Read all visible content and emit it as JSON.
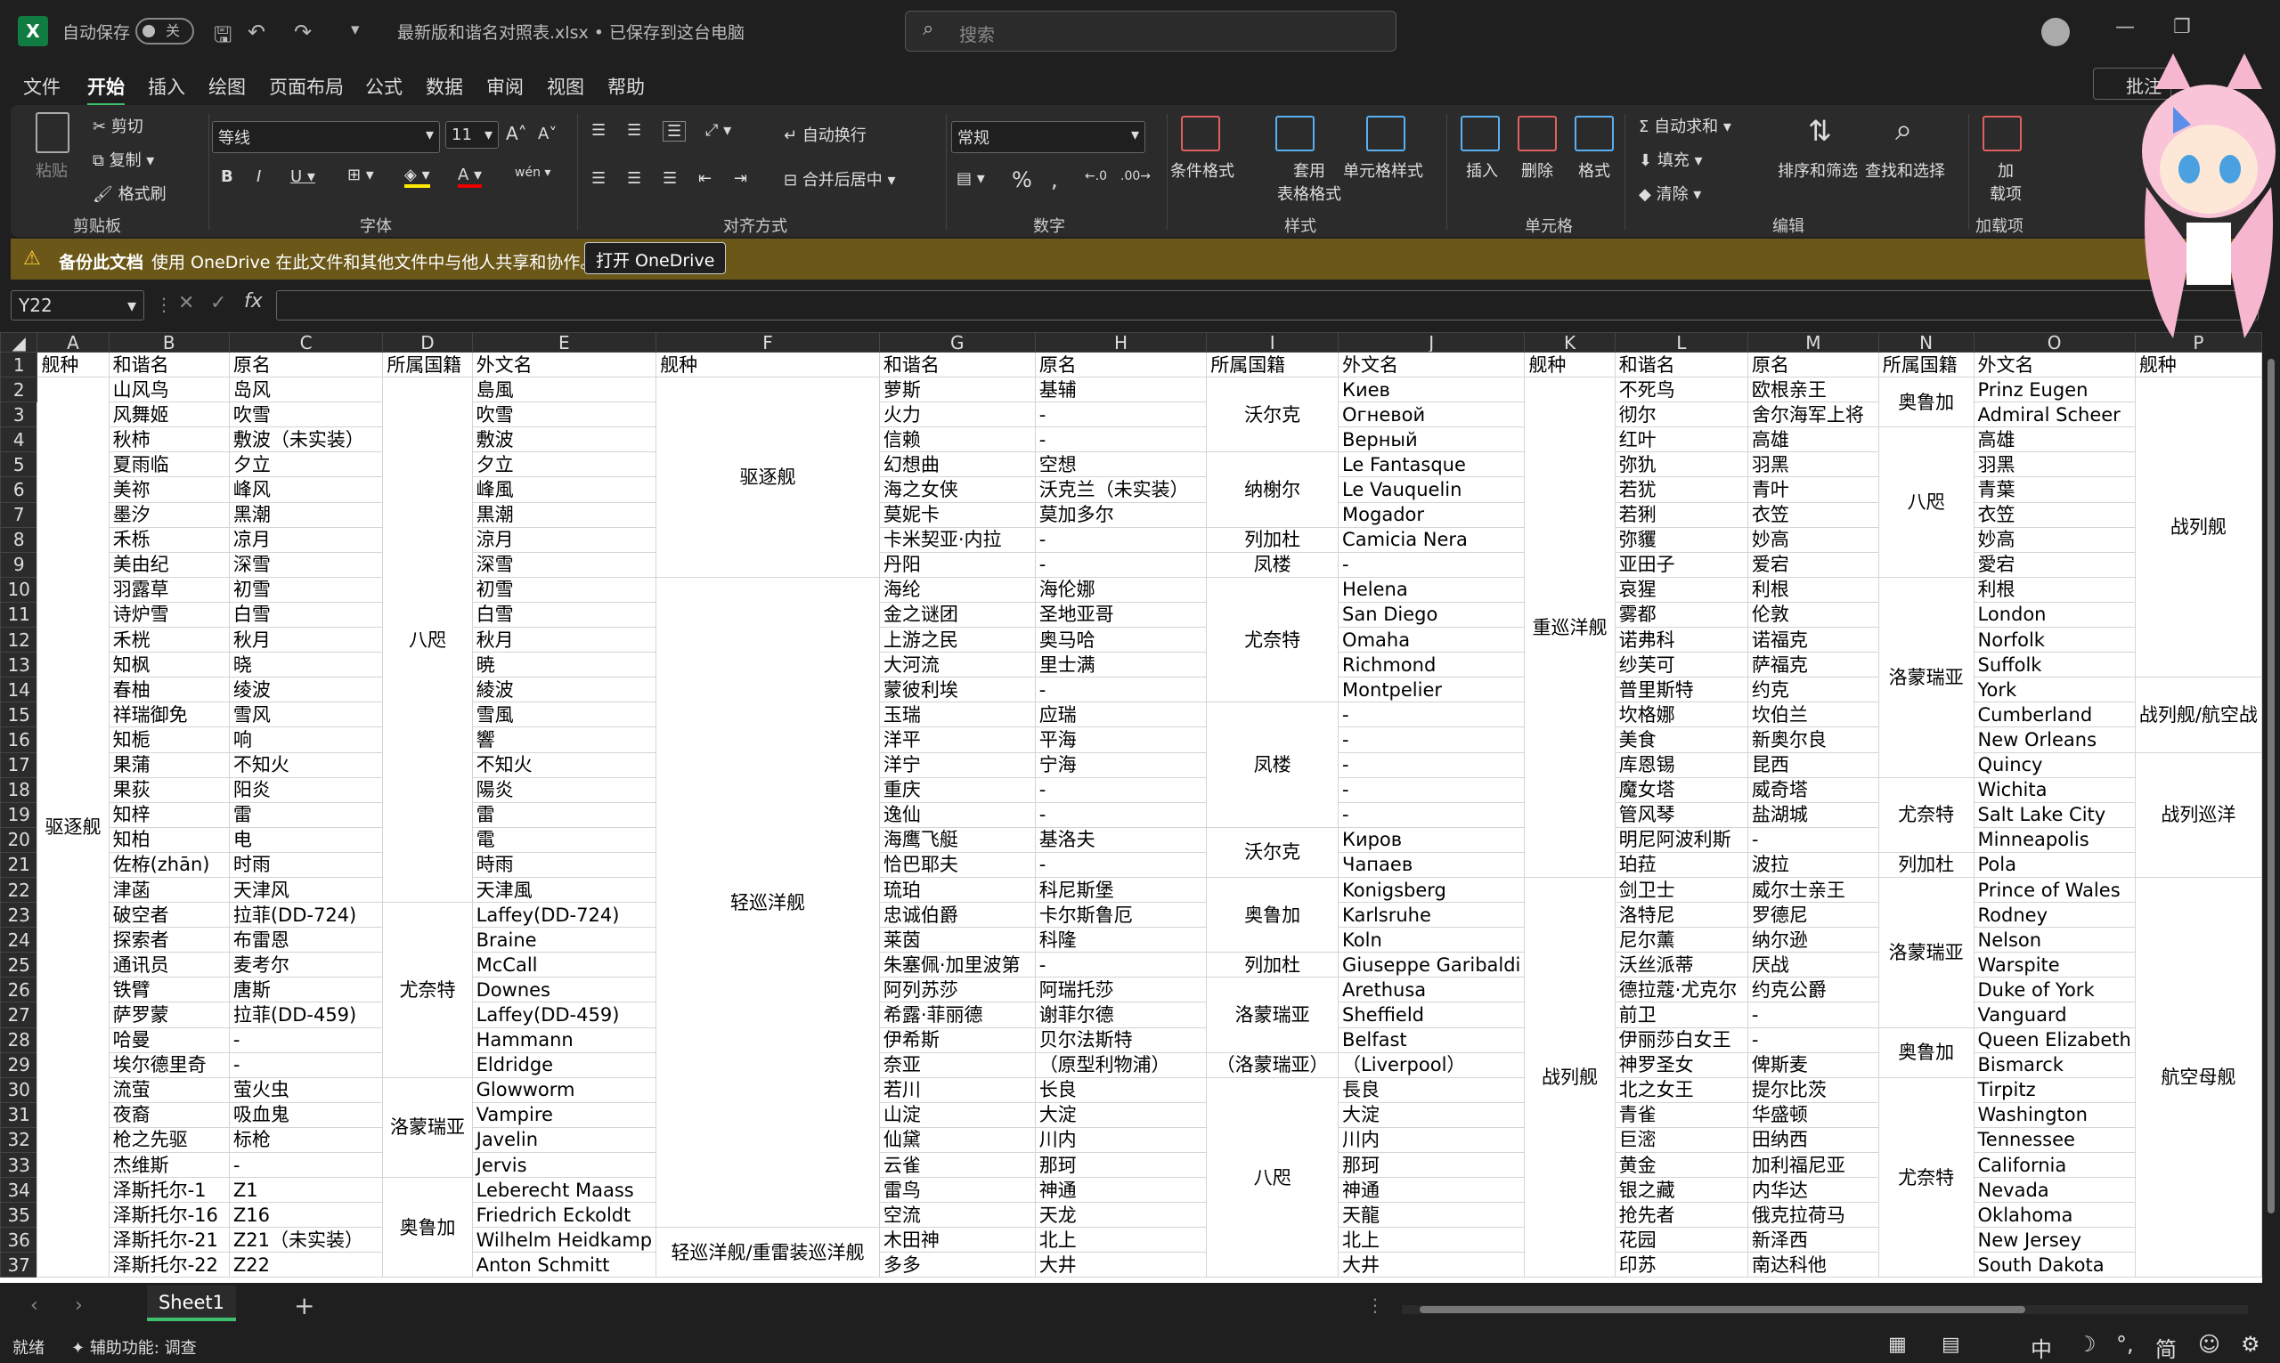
{
  "titlebar": {
    "autosave": "自动保存",
    "autosave_state": "关",
    "filename": "最新版和谐名对照表.xlsx • 已保存到这台电脑",
    "search_placeholder": "搜索"
  },
  "menu": [
    "文件",
    "开始",
    "插入",
    "绘图",
    "页面布局",
    "公式",
    "数据",
    "审阅",
    "视图",
    "帮助"
  ],
  "menu_active": 1,
  "comment_btn": "批注",
  "ribbon": {
    "clipboard": {
      "paste": "粘贴",
      "cut": "剪切",
      "copy": "复制",
      "format_painter": "格式刷",
      "label": "剪贴板"
    },
    "font": {
      "name": "等线",
      "size": "11",
      "label": "字体"
    },
    "align": {
      "wrap": "自动换行",
      "merge": "合并后居中",
      "label": "对齐方式"
    },
    "number": {
      "format": "常规",
      "label": "数字"
    },
    "styles": {
      "cond": "条件格式",
      "table": "套用\n表格格式",
      "cell": "单元格样式",
      "label": "样式"
    },
    "cells": {
      "insert": "插入",
      "delete": "删除",
      "format": "格式",
      "label": "单元格"
    },
    "edit": {
      "autosum": "自动求和",
      "fill": "填充",
      "clear": "清除",
      "sort": "排序和筛选",
      "find": "查找和选择",
      "label": "编辑"
    },
    "addins": {
      "btn": "加\n载项",
      "label": "加载项"
    }
  },
  "infobar": {
    "title": "备份此文档",
    "msg": "使用 OneDrive 在此文件和其他文件中与他人共享和协作。",
    "btn": "打开 OneDrive"
  },
  "namebox": "Y22",
  "columns": [
    "A",
    "B",
    "C",
    "D",
    "E",
    "F",
    "G",
    "H",
    "I",
    "J",
    "K",
    "L",
    "M",
    "N",
    "O",
    "P"
  ],
  "headers": [
    "舰种",
    "和谐名",
    "原名",
    "所属国籍",
    "外文名",
    "舰种",
    "和谐名",
    "原名",
    "所属国籍",
    "外文名",
    "舰种",
    "和谐名",
    "原名",
    "所属国籍",
    "外文名",
    "舰种"
  ],
  "rows": [
    [
      "",
      "山风鸟",
      "岛风",
      "",
      "島風",
      "",
      "萝斯",
      "基辅",
      "",
      "Киев",
      "",
      "不死鸟",
      "欧根亲王",
      "",
      "Prinz Eugen",
      ""
    ],
    [
      "",
      "风舞姬",
      "吹雪",
      "",
      "吹雪",
      "",
      "火力",
      "-",
      "",
      "Огневой",
      "",
      "彻尔",
      "舍尔海军上将",
      "",
      "Admiral Scheer",
      ""
    ],
    [
      "",
      "秋柿",
      "敷波（未实装）",
      "",
      "敷波",
      "",
      "信赖",
      "-",
      "",
      "Верный",
      "",
      "红叶",
      "高雄",
      "",
      "高雄",
      ""
    ],
    [
      "",
      "夏雨临",
      "夕立",
      "",
      "夕立",
      "",
      "幻想曲",
      "空想",
      "",
      "Le Fantasque",
      "",
      "弥犰",
      "羽黑",
      "",
      "羽黑",
      ""
    ],
    [
      "",
      "美祢",
      "峰风",
      "",
      "峰風",
      "",
      "海之女侠",
      "沃克兰（未实装）",
      "",
      "Le Vauquelin",
      "",
      "若犹",
      "青叶",
      "",
      "青葉",
      ""
    ],
    [
      "",
      "墨汐",
      "黑潮",
      "",
      "黒潮",
      "",
      "莫妮卡",
      "莫加多尔",
      "",
      "Mogador",
      "",
      "若猁",
      "衣笠",
      "",
      "衣笠",
      ""
    ],
    [
      "",
      "禾栎",
      "凉月",
      "",
      "涼月",
      "",
      "卡米契亚·内拉",
      "-",
      "",
      "Camicia Nera",
      "",
      "弥貜",
      "妙高",
      "",
      "妙高",
      ""
    ],
    [
      "",
      "美由纪",
      "深雪",
      "",
      "深雪",
      "",
      "丹阳",
      "-",
      "",
      "-",
      "",
      "亚田子",
      "爱宕",
      "",
      "愛宕",
      ""
    ],
    [
      "",
      "羽露草",
      "初雪",
      "",
      "初雪",
      "",
      "海纶",
      "海伦娜",
      "",
      "Helena",
      "",
      "哀猩",
      "利根",
      "",
      "利根",
      ""
    ],
    [
      "",
      "诗炉雪",
      "白雪",
      "",
      "白雪",
      "",
      "金之谜团",
      "圣地亚哥",
      "",
      "San Diego",
      "",
      "雾都",
      "伦敦",
      "",
      "London",
      ""
    ],
    [
      "",
      "禾桄",
      "秋月",
      "",
      "秋月",
      "",
      "上游之民",
      "奥马哈",
      "",
      "Omaha",
      "",
      "诺弗科",
      "诺福克",
      "",
      "Norfolk",
      ""
    ],
    [
      "",
      "知枫",
      "晓",
      "",
      "暁",
      "",
      "大河流",
      "里士满",
      "",
      "Richmond",
      "",
      "纱芙可",
      "萨福克",
      "",
      "Suffolk",
      ""
    ],
    [
      "",
      "春柚",
      "绫波",
      "",
      "綾波",
      "",
      "蒙彼利埃",
      "-",
      "",
      "Montpelier",
      "",
      "普里斯特",
      "约克",
      "",
      "York",
      ""
    ],
    [
      "",
      "祥瑞御免",
      "雪风",
      "",
      "雪風",
      "",
      "玉瑞",
      "应瑞",
      "",
      "-",
      "",
      "坎格娜",
      "坎伯兰",
      "",
      "Cumberland",
      ""
    ],
    [
      "",
      "知栀",
      "响",
      "",
      "響",
      "",
      "洋平",
      "平海",
      "",
      "-",
      "",
      "美食",
      "新奥尔良",
      "",
      "New Orleans",
      ""
    ],
    [
      "",
      "果蒲",
      "不知火",
      "",
      "不知火",
      "",
      "洋宁",
      "宁海",
      "",
      "-",
      "",
      "库恩锡",
      "昆西",
      "",
      "Quincy",
      ""
    ],
    [
      "",
      "果荻",
      "阳炎",
      "",
      "陽炎",
      "",
      "重庆",
      "-",
      "",
      "-",
      "",
      "魔女塔",
      "威奇塔",
      "",
      "Wichita",
      ""
    ],
    [
      "",
      "知梓",
      "雷",
      "",
      "雷",
      "",
      "逸仙",
      "-",
      "",
      "-",
      "",
      "管风琴",
      "盐湖城",
      "",
      "Salt Lake City",
      ""
    ],
    [
      "",
      "知柏",
      "电",
      "",
      "電",
      "",
      "海鹰飞艇",
      "基洛夫",
      "",
      "Киров",
      "",
      "明尼阿波利斯",
      "-",
      "",
      "Minneapolis",
      ""
    ],
    [
      "",
      "佐栫(zhān)",
      "时雨",
      "",
      "時雨",
      "",
      "恰巴耶夫",
      "-",
      "",
      "Чапаев",
      "",
      "珀菈",
      "波拉",
      "",
      "Pola",
      ""
    ],
    [
      "",
      "津菡",
      "天津风",
      "",
      "天津風",
      "",
      "琉珀",
      "科尼斯堡",
      "",
      "Konigsberg",
      "",
      "剑卫士",
      "威尔士亲王",
      "",
      "Prince of Wales",
      ""
    ],
    [
      "",
      "破空者",
      "拉菲(DD-724)",
      "",
      "Laffey(DD-724)",
      "",
      "忠诚伯爵",
      "卡尔斯鲁厄",
      "",
      "Karlsruhe",
      "",
      "洛特尼",
      "罗德尼",
      "",
      "Rodney",
      ""
    ],
    [
      "",
      "探索者",
      "布雷恩",
      "",
      "Braine",
      "",
      "莱茵",
      "科隆",
      "",
      "Koln",
      "",
      "尼尔薰",
      "纳尔逊",
      "",
      "Nelson",
      ""
    ],
    [
      "",
      "通讯员",
      "麦考尔",
      "",
      "McCall",
      "",
      "朱塞佩·加里波第",
      "-",
      "",
      "Giuseppe Garibaldi",
      "",
      "沃丝派蒂",
      "厌战",
      "",
      "Warspite",
      ""
    ],
    [
      "",
      "铁臂",
      "唐斯",
      "",
      "Downes",
      "",
      "阿列苏莎",
      "阿瑞托莎",
      "",
      "Arethusa",
      "",
      "德拉蔻·尤克尔",
      "约克公爵",
      "",
      "Duke of York",
      ""
    ],
    [
      "",
      "萨罗蒙",
      "拉菲(DD-459)",
      "",
      "Laffey(DD-459)",
      "",
      "希露·菲丽德",
      "谢菲尔德",
      "",
      "Sheffield",
      "",
      "前卫",
      "-",
      "",
      "Vanguard",
      ""
    ],
    [
      "",
      "哈曼",
      "-",
      "",
      "Hammann",
      "",
      "伊希斯",
      "贝尔法斯特",
      "",
      "Belfast",
      "",
      "伊丽莎白女王",
      "-",
      "",
      "Queen Elizabeth",
      ""
    ],
    [
      "",
      "埃尔德里奇",
      "-",
      "",
      "Eldridge",
      "",
      "奈亚",
      "（原型利物浦）",
      "",
      "（Liverpool）",
      "",
      "神罗圣女",
      "俾斯麦",
      "",
      "Bismarck",
      ""
    ],
    [
      "",
      "流萤",
      "萤火虫",
      "",
      "Glowworm",
      "",
      "若川",
      "长良",
      "",
      "長良",
      "",
      "北之女王",
      "提尔比茨",
      "",
      "Tirpitz",
      ""
    ],
    [
      "",
      "夜裔",
      "吸血鬼",
      "",
      "Vampire",
      "",
      "山淀",
      "大淀",
      "",
      "大淀",
      "",
      "青雀",
      "华盛顿",
      "",
      "Washington",
      ""
    ],
    [
      "",
      "枪之先驱",
      "标枪",
      "",
      "Javelin",
      "",
      "仙黛",
      "川内",
      "",
      "川内",
      "",
      "巨滵",
      "田纳西",
      "",
      "Tennessee",
      ""
    ],
    [
      "",
      "杰维斯",
      "-",
      "",
      "Jervis",
      "",
      "云雀",
      "那珂",
      "",
      "那珂",
      "",
      "黄金",
      "加利福尼亚",
      "",
      "California",
      ""
    ],
    [
      "",
      "泽斯托尔-1",
      "Z1",
      "",
      "Leberecht Maass",
      "",
      "雷鸟",
      "神通",
      "",
      "神通",
      "",
      "银之藏",
      "内华达",
      "",
      "Nevada",
      ""
    ],
    [
      "",
      "泽斯托尔-16",
      "Z16",
      "",
      "Friedrich Eckoldt",
      "",
      "空流",
      "天龙",
      "",
      "天龍",
      "",
      "抢先者",
      "俄克拉荷马",
      "",
      "Oklahoma",
      ""
    ],
    [
      "",
      "泽斯托尔-21",
      "Z21（未实装）",
      "",
      "Wilhelm Heidkamp",
      "",
      "木田神",
      "北上",
      "",
      "北上",
      "",
      "花园",
      "新泽西",
      "",
      "New Jersey",
      ""
    ],
    [
      "",
      "泽斯托尔-22",
      "Z22",
      "",
      "Anton Schmitt",
      "",
      "多多",
      "大井",
      "",
      "大井",
      "",
      "印苏",
      "南达科他",
      "",
      "South Dakota",
      ""
    ]
  ],
  "merges": {
    "A": [
      {
        "r": 2,
        "span": 36,
        "t": "驱逐舰"
      }
    ],
    "D": [
      {
        "r": 2,
        "span": 21,
        "t": "八咫"
      },
      {
        "r": 23,
        "span": 7,
        "t": "尤奈特"
      },
      {
        "r": 30,
        "span": 4,
        "t": "洛蒙瑞亚"
      },
      {
        "r": 34,
        "span": 4,
        "t": "奥鲁加"
      }
    ],
    "F": [
      {
        "r": 2,
        "span": 8,
        "t": "驱逐舰"
      },
      {
        "r": 10,
        "span": 26,
        "t": "轻巡洋舰"
      },
      {
        "r": 36,
        "span": 2,
        "t": "轻巡洋舰/重雷装巡洋舰"
      }
    ],
    "I": [
      {
        "r": 2,
        "span": 3,
        "t": "沃尔克"
      },
      {
        "r": 5,
        "span": 3,
        "t": "纳榭尔"
      },
      {
        "r": 8,
        "span": 1,
        "t": "列加杜"
      },
      {
        "r": 9,
        "span": 1,
        "t": "凤楼"
      },
      {
        "r": 10,
        "span": 5,
        "t": "尤奈特"
      },
      {
        "r": 15,
        "span": 5,
        "t": "凤楼"
      },
      {
        "r": 20,
        "span": 2,
        "t": "沃尔克"
      },
      {
        "r": 22,
        "span": 3,
        "t": "奥鲁加"
      },
      {
        "r": 25,
        "span": 1,
        "t": "列加杜"
      },
      {
        "r": 26,
        "span": 3,
        "t": "洛蒙瑞亚"
      },
      {
        "r": 29,
        "span": 1,
        "t": "（洛蒙瑞亚）"
      },
      {
        "r": 30,
        "span": 8,
        "t": "八咫"
      }
    ],
    "K": [
      {
        "r": 2,
        "span": 20,
        "t": "重巡洋舰"
      },
      {
        "r": 22,
        "span": 16,
        "t": "战列舰"
      }
    ],
    "N": [
      {
        "r": 2,
        "span": 2,
        "t": "奥鲁加"
      },
      {
        "r": 4,
        "span": 6,
        "t": "八咫"
      },
      {
        "r": 10,
        "span": 8,
        "t": "洛蒙瑞亚"
      },
      {
        "r": 18,
        "span": 3,
        "t": "尤奈特"
      },
      {
        "r": 21,
        "span": 1,
        "t": "列加杜"
      },
      {
        "r": 22,
        "span": 6,
        "t": "洛蒙瑞亚"
      },
      {
        "r": 28,
        "span": 2,
        "t": "奥鲁加"
      },
      {
        "r": 30,
        "span": 8,
        "t": "尤奈特"
      }
    ],
    "P": [
      {
        "r": 2,
        "span": 12,
        "t": "战列舰"
      },
      {
        "r": 14,
        "span": 3,
        "t": "战列舰/航空战"
      },
      {
        "r": 17,
        "span": 5,
        "t": "战列巡洋"
      },
      {
        "r": 22,
        "span": 16,
        "t": "航空母舰"
      }
    ]
  },
  "sheet_tab": "Sheet1",
  "status": {
    "ready": "就绪",
    "access": "辅助功能: 调查"
  },
  "ime": [
    "中",
    "简"
  ]
}
